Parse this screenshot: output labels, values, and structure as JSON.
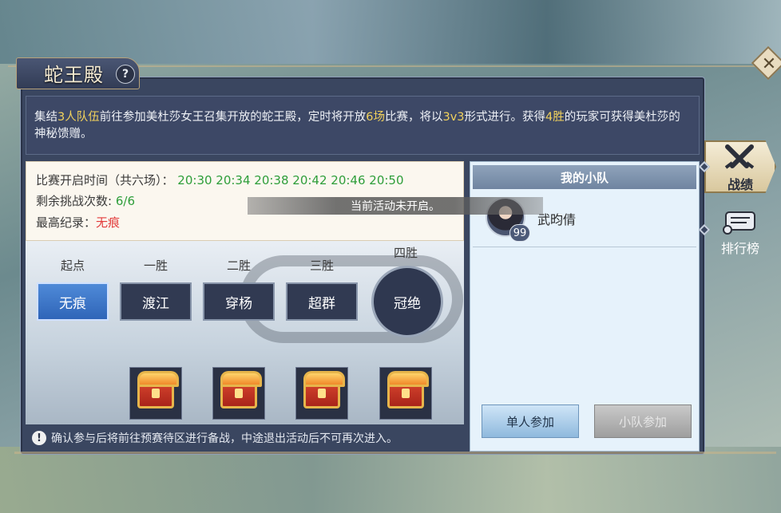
{
  "title": "蛇王殿",
  "help_label": "?",
  "close_label": "✕",
  "description": {
    "p1": "集结",
    "h1": "3人队伍",
    "p2": "前往参加美杜莎女王召集开放的蛇王殿，定时将开放",
    "h2": "6场",
    "p3": "比赛，将以",
    "h3": "3v3",
    "p4": "形式进行。获得",
    "h4": "4胜",
    "p5": "的玩家可获得美杜莎的神秘馈赠。"
  },
  "info": {
    "schedule_label": "比赛开启时间（共六场）：",
    "schedule_times": "20:30 20:34 20:38 20:42 20:46 20:50",
    "attempts_label": "剩余挑战次数:",
    "attempts_value": "6/6",
    "record_label": "最高纪录：",
    "record_value": "无痕"
  },
  "stages": [
    {
      "label": "起点",
      "name": "无痕"
    },
    {
      "label": "一胜",
      "name": "渡江"
    },
    {
      "label": "二胜",
      "name": "穿杨"
    },
    {
      "label": "三胜",
      "name": "超群"
    },
    {
      "label": "四胜",
      "name": "冠绝"
    }
  ],
  "notice": "确认参与后将前往预赛待区进行备战，中途退出活动后不可再次进入。",
  "toast": "当前活动未开启。",
  "team": {
    "header": "我的小队",
    "member_name": "武昀倩",
    "member_level": "99",
    "solo_button": "单人参加",
    "team_button": "小队参加"
  },
  "side_tabs": {
    "record": "战绩",
    "ranking": "排行榜"
  },
  "colors": {
    "highlight": "#f2d25c",
    "green": "#2e9e3a",
    "red": "#e23a3a"
  }
}
